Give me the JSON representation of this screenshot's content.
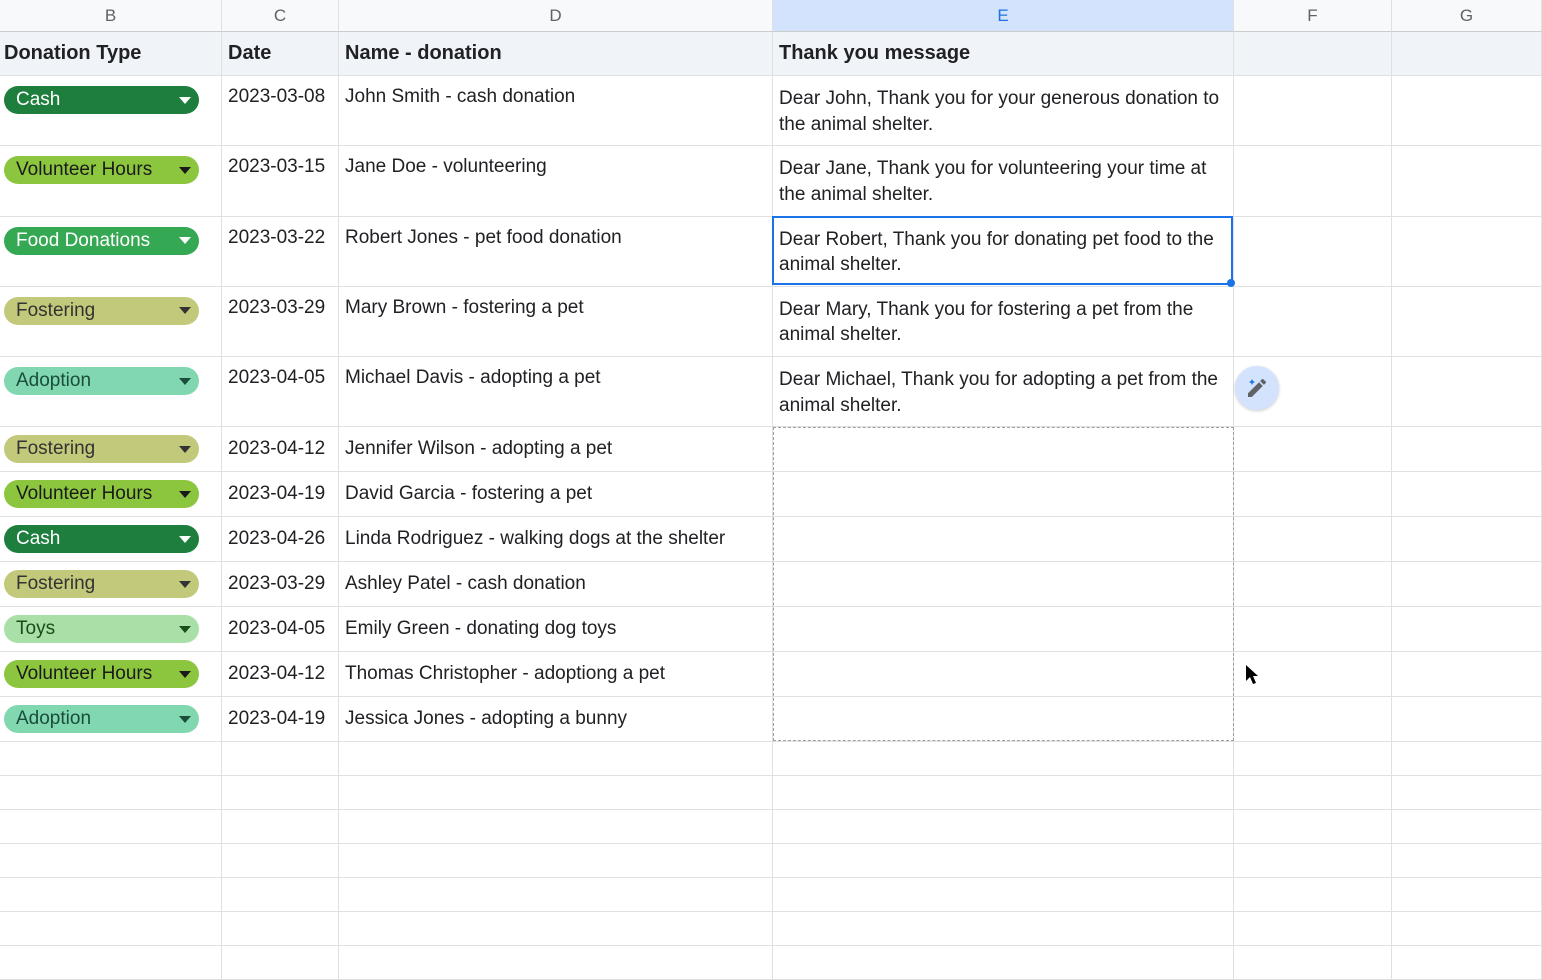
{
  "columns": {
    "b": "B",
    "c": "C",
    "d": "D",
    "e": "E",
    "f": "F",
    "g": "G"
  },
  "headers": {
    "donation_type": "Donation Type",
    "date": "Date",
    "name_donation": "Name - donation",
    "thank_you": "Thank you message"
  },
  "chip_labels": {
    "cash": "Cash",
    "volunteer": "Volunteer Hours",
    "food": "Food Donations",
    "fostering": "Fostering",
    "adoption": "Adoption",
    "toys": "Toys"
  },
  "rows": [
    {
      "type": "cash",
      "date": "2023-03-08",
      "name": "John Smith - cash donation",
      "message": "Dear John, Thank you for your generous donation to the animal shelter."
    },
    {
      "type": "volunteer",
      "date": "2023-03-15",
      "name": "Jane Doe - volunteering",
      "message": "Dear Jane, Thank you for volunteering your time at the animal shelter."
    },
    {
      "type": "food",
      "date": "2023-03-22",
      "name": "Robert Jones - pet food donation",
      "message": "Dear Robert, Thank you for donating pet food to the animal shelter."
    },
    {
      "type": "fostering",
      "date": "2023-03-29",
      "name": "Mary Brown - fostering a pet",
      "message": "Dear Mary, Thank you for fostering a pet from the animal shelter."
    },
    {
      "type": "adoption",
      "date": "2023-04-05",
      "name": "Michael Davis - adopting a pet",
      "message": "Dear Michael, Thank you for adopting a pet from the animal shelter."
    },
    {
      "type": "fostering",
      "date": "2023-04-12",
      "name": "Jennifer Wilson - adopting a pet",
      "message": ""
    },
    {
      "type": "volunteer",
      "date": "2023-04-19",
      "name": "David Garcia - fostering a pet",
      "message": ""
    },
    {
      "type": "cash",
      "date": "2023-04-26",
      "name": "Linda Rodriguez - walking dogs at the shelter",
      "message": ""
    },
    {
      "type": "fostering",
      "date": "2023-03-29",
      "name": "Ashley Patel - cash donation",
      "message": ""
    },
    {
      "type": "toys",
      "date": "2023-04-05",
      "name": "Emily Green - donating dog toys",
      "message": ""
    },
    {
      "type": "volunteer",
      "date": "2023-04-12",
      "name": "Thomas Christopher - adoptiong a pet",
      "message": ""
    },
    {
      "type": "adoption",
      "date": "2023-04-19",
      "name": "Jessica Jones - adopting a bunny",
      "message": ""
    }
  ],
  "chip_classes": {
    "cash": "chip-cash",
    "volunteer": "chip-volunteer",
    "food": "chip-food",
    "fostering": "chip-fostering",
    "adoption": "chip-adoption",
    "toys": "chip-toys"
  },
  "selected_cell_row_index": 2,
  "dashed_range_start": 5,
  "dashed_range_end": 11
}
